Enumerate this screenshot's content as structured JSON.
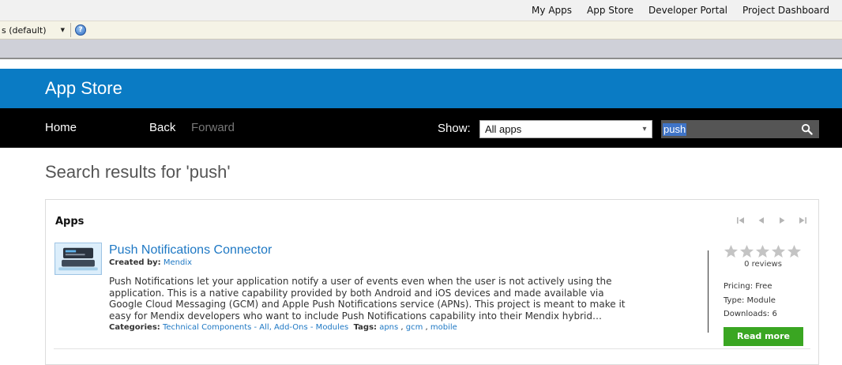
{
  "top_links": [
    "My Apps",
    "App Store",
    "Developer Portal",
    "Project Dashboard"
  ],
  "toolbar": {
    "theme_select_value": "s (default)"
  },
  "header": {
    "title": "App Store"
  },
  "nav": {
    "home": "Home",
    "back": "Back",
    "forward": "Forward",
    "show_label": "Show:",
    "show_value": "All apps",
    "search_value": "push"
  },
  "search": {
    "results_title": "Search results for 'push'"
  },
  "panel": {
    "title": "Apps",
    "app": {
      "name": "Push Notifications Connector",
      "created_by_label": "Created by:",
      "created_by": "Mendix",
      "description": "Push Notifications let your application notify a user of events even when the user is not actively using the application. This is a native capability provided by both Android and iOS devices and made available via Google Cloud Messaging (GCM) and Apple Push Notifications service (APNs). This project is meant to make it easy for Mendix developers who want to include Push Notifications capability into their Mendix hybrid…",
      "categories_label": "Categories:",
      "categories": "Technical Components - All, Add-Ons - Modules",
      "tags_label": "Tags:",
      "tags": [
        "apns",
        "gcm",
        "mobile"
      ],
      "rating": 0,
      "reviews": "0 reviews",
      "pricing_label": "Pricing:",
      "pricing": "Free",
      "type_label": "Type:",
      "type": "Module",
      "downloads_label": "Downloads:",
      "downloads": "6",
      "read_more": "Read more"
    }
  },
  "colors": {
    "brand_blue": "#0a7bc4",
    "nav_black": "#000000",
    "link_blue": "#1e78c4",
    "button_green": "#3aa622"
  }
}
